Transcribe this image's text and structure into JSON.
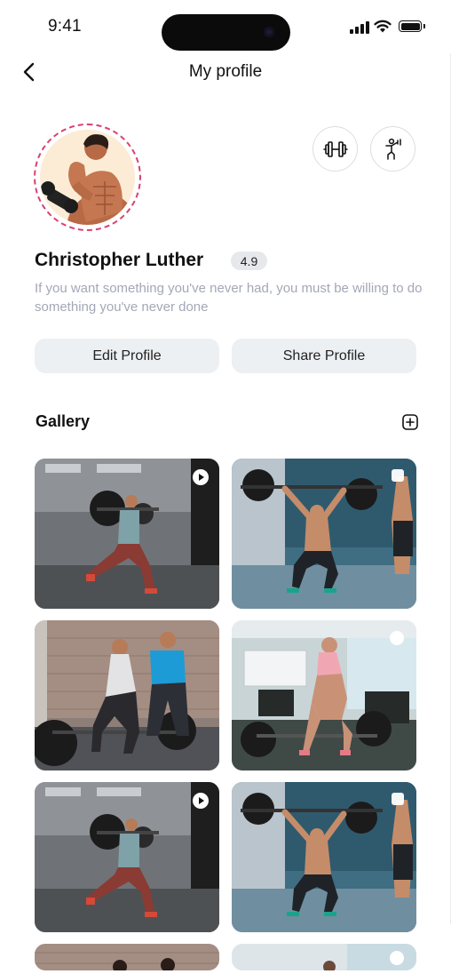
{
  "status_bar": {
    "time": "9:41"
  },
  "header": {
    "title": "My profile"
  },
  "profile": {
    "name": "Christopher Luther",
    "rating": "4.9",
    "bio": "If you want something you've never had, you must be willing to do something you've never done"
  },
  "actions": {
    "edit_label": "Edit Profile",
    "share_label": "Share Profile"
  },
  "gallery": {
    "title": "Gallery"
  },
  "colors": {
    "avatar_ring": "#d8426e",
    "pill_bg": "#edf0f3",
    "bio_text": "#a3a8b6"
  },
  "icons": [
    "back-arrow-icon",
    "dumbbell-icon",
    "exercise-person-icon",
    "add-square-icon",
    "play-icon"
  ]
}
